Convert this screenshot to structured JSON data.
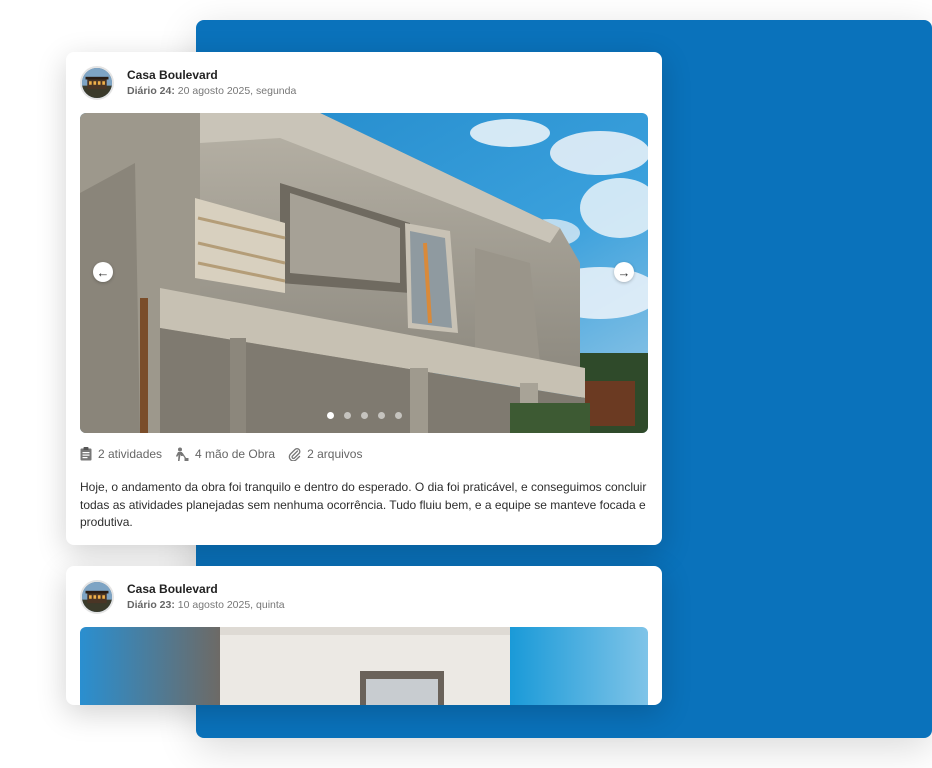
{
  "posts": [
    {
      "project": "Casa Boulevard",
      "diary_label": "Diário 24:",
      "date": "20 agosto 2025, segunda",
      "slides": {
        "count": 5,
        "active": 1
      },
      "stats": {
        "activities": "2 atividades",
        "labor": "4 mão de Obra",
        "files": "2 arquivos"
      },
      "description": "Hoje, o andamento da obra foi tranquilo e dentro do esperado. O dia foi praticável, e conseguimos concluir todas as atividades planejadas sem nenhuma ocorrência. Tudo fluiu bem, e a equipe se manteve focada e produtiva."
    },
    {
      "project": "Casa Boulevard",
      "diary_label": "Diário 23:",
      "date": "10 agosto 2025, quinta"
    }
  ],
  "icons": {
    "prev": "arrow-left-icon",
    "next": "arrow-right-icon",
    "activities": "clipboard-icon",
    "labor": "worker-icon",
    "files": "paperclip-icon"
  },
  "colors": {
    "panel_blue": "#0a72bb",
    "card_bg": "#ffffff",
    "muted_text": "#777777"
  }
}
